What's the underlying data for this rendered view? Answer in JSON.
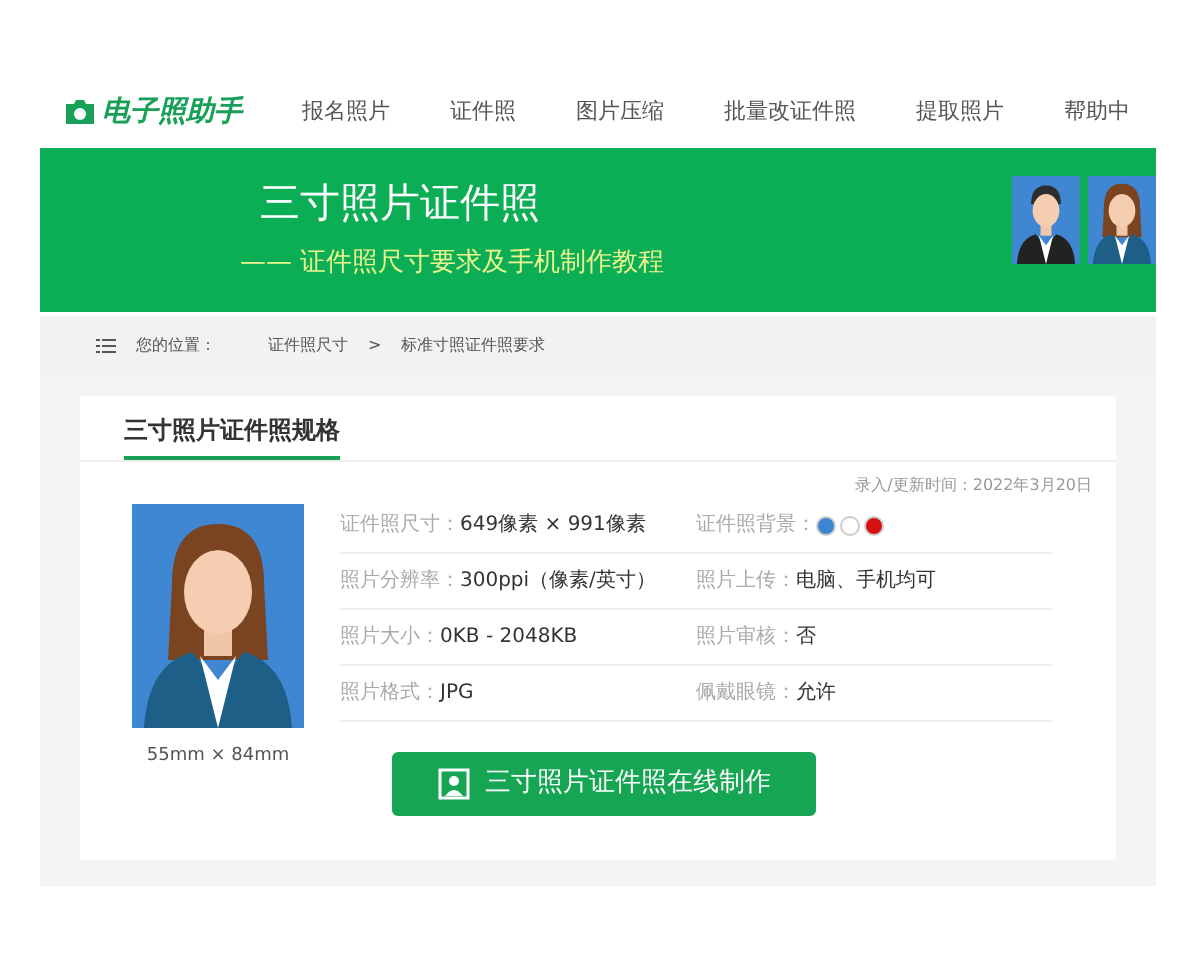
{
  "nav": {
    "logo": "电子照助手",
    "items": [
      "报名照片",
      "证件照",
      "图片压缩",
      "批量改证件照",
      "提取照片",
      "帮助中"
    ]
  },
  "banner": {
    "title": "三寸照片证件照",
    "subtitle": "—— 证件照尺寸要求及手机制作教程"
  },
  "breadcrumb": {
    "label": "您的位置：",
    "items": [
      "证件照尺寸",
      "标准寸照证件照要求"
    ],
    "separator": ">"
  },
  "spec": {
    "heading": "三寸照片证件照规格",
    "updated": "录入/更新时间：2022年3月20日",
    "photo_caption": "55mm × 84mm",
    "fields": [
      {
        "kind": "text",
        "label": "证件照尺寸：",
        "value": "649像素 × 991像素"
      },
      {
        "kind": "colors",
        "label": "证件照背景：",
        "colors": [
          {
            "color": "#3d85d1"
          },
          {
            "color": "#ffffff"
          },
          {
            "color": "#d81010"
          }
        ]
      },
      {
        "kind": "text",
        "label": "照片分辨率：",
        "value": "300ppi（像素/英寸）"
      },
      {
        "kind": "text",
        "label": "照片上传：",
        "value": "电脑、手机均可"
      },
      {
        "kind": "text",
        "label": "照片大小：",
        "value": "0KB - 2048KB"
      },
      {
        "kind": "text",
        "label": "照片审核：",
        "value": "否"
      },
      {
        "kind": "text",
        "label": "照片格式：",
        "value": "JPG"
      },
      {
        "kind": "text",
        "label": "佩戴眼镜：",
        "value": "允许"
      }
    ],
    "button": "三寸照片证件照在线制作"
  }
}
